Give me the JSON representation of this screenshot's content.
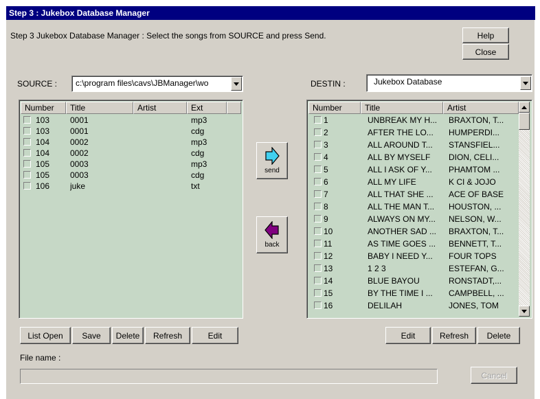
{
  "window": {
    "title": "Step 3 : Jukebox Database Manager"
  },
  "instruction": "Step 3  Jukebox Database Manager : Select the songs from SOURCE and press Send.",
  "buttons": {
    "help": "Help",
    "close": "Close",
    "send": "send",
    "back": "back",
    "cancel": "Cancel"
  },
  "source": {
    "label": "SOURCE :",
    "path": "c:\\program files\\cavs\\JBManager\\wo",
    "columns": [
      "Number",
      "Title",
      "Artist",
      "Ext"
    ],
    "rows": [
      {
        "number": "103",
        "title": "0001",
        "artist": "",
        "ext": "mp3"
      },
      {
        "number": "103",
        "title": "0001",
        "artist": "",
        "ext": "cdg"
      },
      {
        "number": "104",
        "title": "0002",
        "artist": "",
        "ext": "mp3"
      },
      {
        "number": "104",
        "title": "0002",
        "artist": "",
        "ext": "cdg"
      },
      {
        "number": "105",
        "title": "0003",
        "artist": "",
        "ext": "mp3"
      },
      {
        "number": "105",
        "title": "0003",
        "artist": "",
        "ext": "cdg"
      },
      {
        "number": "106",
        "title": "juke",
        "artist": "",
        "ext": "txt"
      }
    ],
    "buttons": {
      "list_open": "List Open",
      "save": "Save",
      "delete": "Delete",
      "refresh": "Refresh",
      "edit": "Edit"
    }
  },
  "destin": {
    "label": "DESTIN :",
    "value": "Jukebox Database",
    "columns": [
      "Number",
      "Title",
      "Artist"
    ],
    "rows": [
      {
        "number": "1",
        "title": "UNBREAK MY H...",
        "artist": "BRAXTON, T..."
      },
      {
        "number": "2",
        "title": "AFTER THE LO...",
        "artist": "HUMPERDI..."
      },
      {
        "number": "3",
        "title": "ALL AROUND T...",
        "artist": "STANSFIEL..."
      },
      {
        "number": "4",
        "title": "ALL BY MYSELF",
        "artist": "DION, CELI..."
      },
      {
        "number": "5",
        "title": "ALL I ASK OF Y...",
        "artist": "PHAMTOM ..."
      },
      {
        "number": "6",
        "title": "ALL MY LIFE",
        "artist": "K CI & JOJO"
      },
      {
        "number": "7",
        "title": "ALL THAT SHE ...",
        "artist": "ACE OF BASE"
      },
      {
        "number": "8",
        "title": "ALL THE MAN T...",
        "artist": "HOUSTON, ..."
      },
      {
        "number": "9",
        "title": "ALWAYS ON MY...",
        "artist": "NELSON, W..."
      },
      {
        "number": "10",
        "title": "ANOTHER SAD ...",
        "artist": "BRAXTON, T..."
      },
      {
        "number": "11",
        "title": "AS TIME GOES ...",
        "artist": "BENNETT, T..."
      },
      {
        "number": "12",
        "title": "BABY I NEED Y...",
        "artist": "FOUR TOPS"
      },
      {
        "number": "13",
        "title": "1 2 3",
        "artist": "ESTEFAN, G..."
      },
      {
        "number": "14",
        "title": "BLUE BAYOU",
        "artist": "RONSTADT,..."
      },
      {
        "number": "15",
        "title": "BY THE TIME I ...",
        "artist": "CAMPBELL, ..."
      },
      {
        "number": "16",
        "title": "DELILAH",
        "artist": "JONES, TOM"
      }
    ],
    "buttons": {
      "edit": "Edit",
      "refresh": "Refresh",
      "delete": "Delete"
    }
  },
  "file_name_label": "File name :",
  "colors": {
    "list_bg": "#c6d8c6",
    "titlebar": "#000080",
    "send_arrow": "#40d0f0",
    "back_arrow": "#800080"
  }
}
